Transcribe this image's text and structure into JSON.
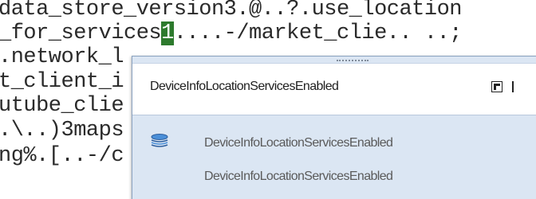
{
  "editor": {
    "lines": [
      {
        "text": "data_store_version3.@..?.use_location"
      },
      {
        "before": "_for_services",
        "highlight": "1",
        "after": "....-/market_clie.. ..;"
      },
      {
        "text": ".network_l"
      },
      {
        "text": "t_client_i"
      },
      {
        "text": "utube_clie"
      },
      {
        "text": ".\\..)3maps"
      },
      {
        "text": "ng%.[..-/c"
      },
      {
        "text": ""
      }
    ]
  },
  "popup": {
    "title": "DeviceInfoLocationServicesEnabled",
    "items": [
      {
        "label": "DeviceInfoLocationServicesEnabled",
        "icon": "stacked-layers-icon"
      },
      {
        "label": "DeviceInfoLocationServicesEnabled",
        "icon": ""
      }
    ],
    "colors": {
      "background": "#dbe6f3",
      "header": "#ffffff",
      "highlight": "#2d7a2d"
    }
  }
}
